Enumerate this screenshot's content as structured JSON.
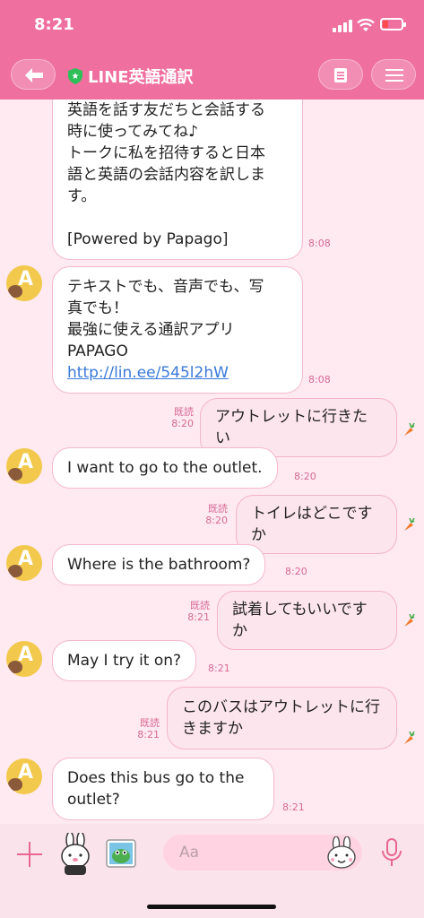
{
  "status": {
    "time": "8:21"
  },
  "header": {
    "title": "LINE英語通訳"
  },
  "colors": {
    "header_bg": "#ef6f9f",
    "chat_bg": "#ffeaf1",
    "link": "#3a79d8",
    "timestamp": "#d66a92"
  },
  "messages": [
    {
      "from": "bot",
      "lines": [
        "英語を話す友だちと会話する",
        "時に使ってみてね♪",
        "トークに私を招待すると日本",
        "語と英語の会話内容を訳しま",
        "す。",
        "",
        "[Powered by Papago]"
      ],
      "time": "8:08"
    },
    {
      "from": "bot",
      "lines": [
        "テキストでも、音声でも、写",
        "真でも！",
        "最強に使える通訳アプリ",
        "PAPAGO"
      ],
      "link": "http://lin.ee/545l2hW",
      "time": "8:08"
    },
    {
      "from": "me",
      "text": "アウトレットに行きたい",
      "read": "既読",
      "time": "8:20"
    },
    {
      "from": "bot",
      "text": "I want to go to the outlet.",
      "time": "8:20"
    },
    {
      "from": "me",
      "text": "トイレはどこですか",
      "read": "既読",
      "time": "8:20"
    },
    {
      "from": "bot",
      "text": "Where is the bathroom?",
      "time": "8:20"
    },
    {
      "from": "me",
      "text": "試着してもいいですか",
      "read": "既読",
      "time": "8:21"
    },
    {
      "from": "bot",
      "text": "May I try it on?",
      "time": "8:21"
    },
    {
      "from": "me",
      "lines": [
        "このバスはアウトレットに行",
        "きますか"
      ],
      "read": "既読",
      "time": "8:21"
    },
    {
      "from": "bot",
      "lines": [
        "Does this bus go to the",
        "outlet?"
      ],
      "time": "8:21"
    }
  ],
  "input": {
    "placeholder": "Aa",
    "value": ""
  },
  "icons": [
    "back-arrow-icon",
    "verified-shield-icon",
    "note-icon",
    "menu-icon",
    "plus-icon",
    "sticker-icon",
    "photo-icon",
    "emoji-icon",
    "microphone-icon",
    "carrot-icon"
  ]
}
